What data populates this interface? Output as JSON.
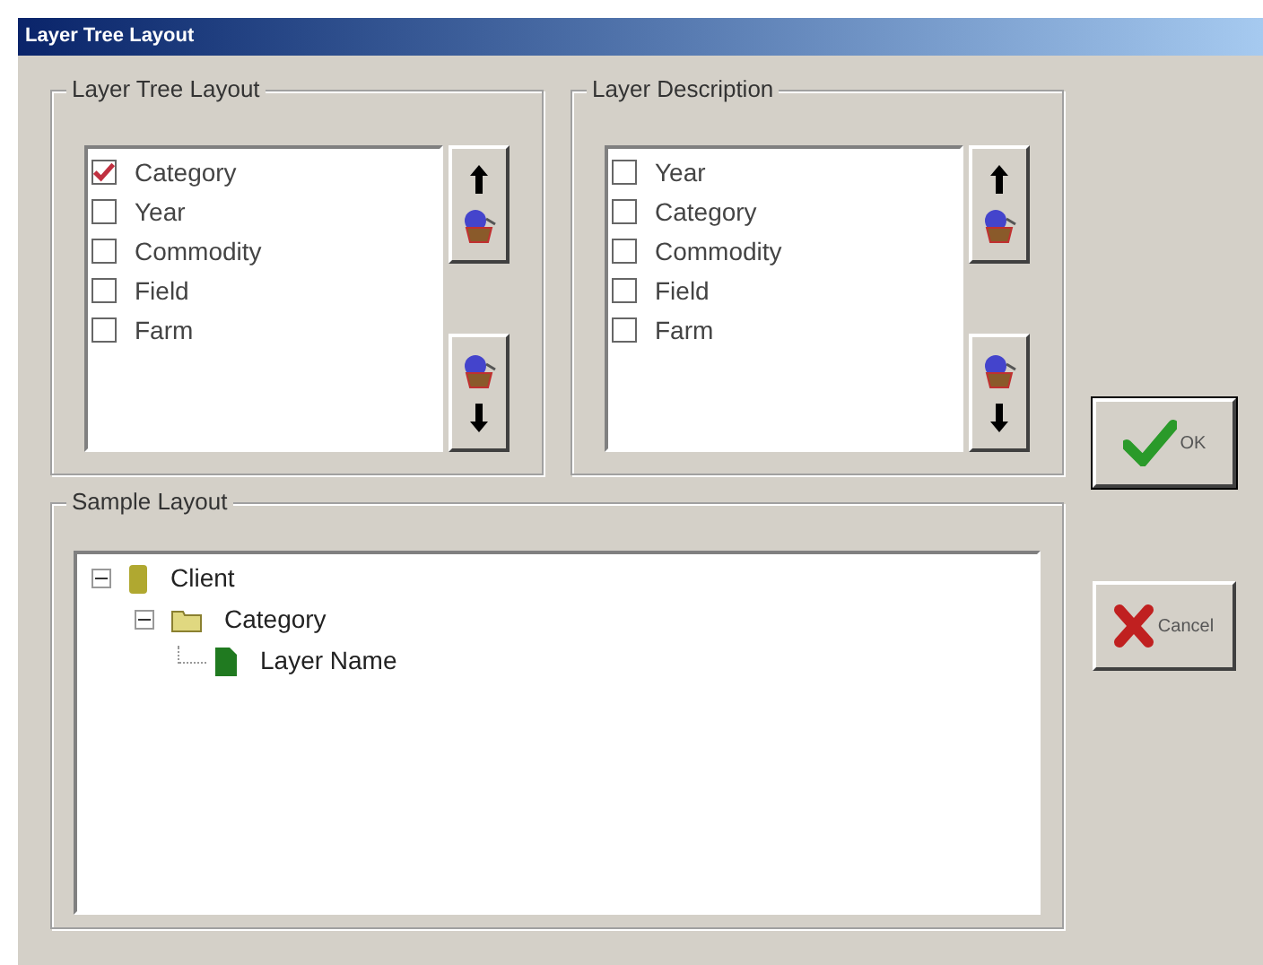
{
  "window": {
    "title": "Layer Tree Layout"
  },
  "layer_tree_layout": {
    "title": "Layer Tree Layout",
    "items": [
      {
        "label": "Category",
        "checked": true
      },
      {
        "label": "Year",
        "checked": false
      },
      {
        "label": "Commodity",
        "checked": false
      },
      {
        "label": "Field",
        "checked": false
      },
      {
        "label": "Farm",
        "checked": false
      }
    ]
  },
  "layer_description": {
    "title": "Layer Description",
    "items": [
      {
        "label": "Year",
        "checked": false
      },
      {
        "label": "Category",
        "checked": false
      },
      {
        "label": "Commodity",
        "checked": false
      },
      {
        "label": "Field",
        "checked": false
      },
      {
        "label": "Farm",
        "checked": false
      }
    ]
  },
  "sample_layout": {
    "title": "Sample Layout",
    "tree": [
      {
        "label": "Client",
        "kind": "client",
        "expanded": true,
        "children": [
          {
            "label": "Category",
            "kind": "folder",
            "expanded": true,
            "children": [
              {
                "label": "Layer Name",
                "kind": "layer"
              }
            ]
          }
        ]
      }
    ]
  },
  "buttons": [
    {
      "label": "OK",
      "kind": "ok"
    },
    {
      "label": "Cancel",
      "kind": "cancel"
    }
  ]
}
